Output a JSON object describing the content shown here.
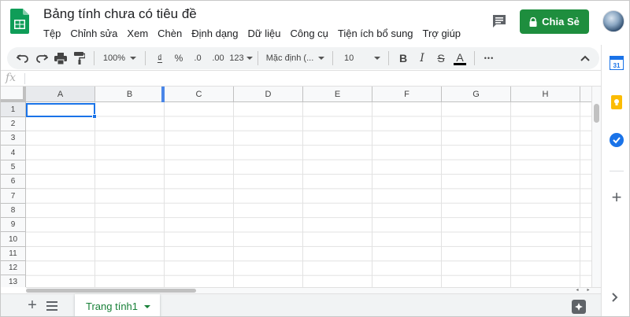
{
  "header": {
    "title": "Bảng tính chưa có tiêu đề",
    "menu": [
      "Tệp",
      "Chỉnh sửa",
      "Xem",
      "Chèn",
      "Định dạng",
      "Dữ liệu",
      "Công cụ",
      "Tiện ích bổ sung",
      "Trợ giúp"
    ],
    "share_label": "Chia Sẻ",
    "accent": "#1e8e3e"
  },
  "toolbar": {
    "zoom": "100%",
    "currency": "₫",
    "percent": "%",
    "decrease_decimal": ".0",
    "increase_decimal": ".00",
    "more_formats": "123",
    "font": "Mặc định (...",
    "font_size": "10",
    "bold": "B",
    "italic": "I",
    "strike": "S",
    "text_color": "A",
    "more": "•••"
  },
  "formula_bar": {
    "fx": "fx",
    "value": ""
  },
  "grid": {
    "columns": [
      "A",
      "B",
      "C",
      "D",
      "E",
      "F",
      "G",
      "H"
    ],
    "rows": [
      "1",
      "2",
      "3",
      "4",
      "5",
      "6",
      "7",
      "8",
      "9",
      "10",
      "11",
      "12",
      "13"
    ],
    "selected_cell": "A1"
  },
  "sheets": {
    "tabs": [
      {
        "label": "Trang tính1"
      }
    ]
  },
  "side_panel": {
    "calendar_day": "31",
    "colors": {
      "calendar": "#1a73e8",
      "keep": "#fbbc04",
      "tasks": "#1a73e8"
    }
  }
}
